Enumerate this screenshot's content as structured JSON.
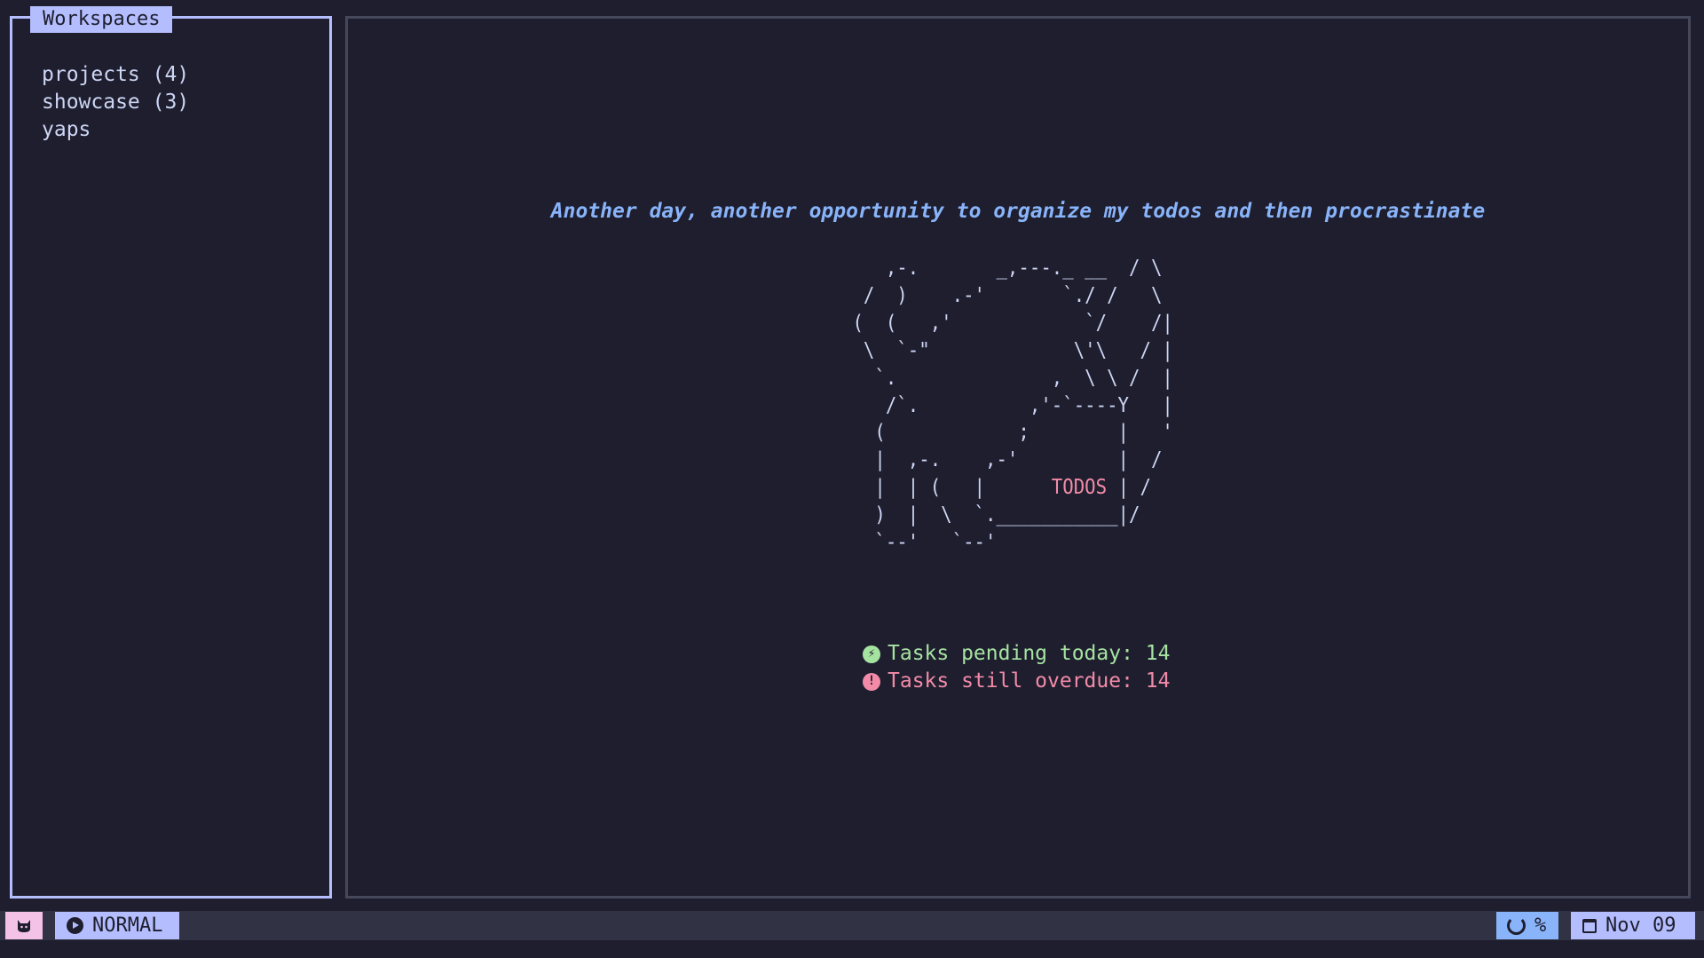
{
  "sidebar": {
    "title": "Workspaces",
    "items": [
      {
        "label": "projects (4)"
      },
      {
        "label": "showcase (3)"
      },
      {
        "label": "yaps"
      }
    ]
  },
  "main": {
    "tagline": "Another day, another opportunity to organize my todos and then procrastinate",
    "ascii_art": {
      "before": "    ,-.       _,---._ __  / \\\n  /  )    .-'       `./ /   \\\n (  (   ,'            `/    /|\n  \\  `-\"             \\'\\   / |\n   `.              ,  \\ \\ /  |\n    /`.          ,'-`----Y   |\n   (            ;        |   '\n   |  ,-.    ,-'         |  /\n   |  | (   |      ",
      "label": "TODOS",
      "after": " | /\n   )  |  \\  `.___________|/\n   `--'   `--'"
    },
    "stats": {
      "pending_label": "Tasks pending today: 14",
      "overdue_label": "Tasks still overdue: 14"
    }
  },
  "statusbar": {
    "cat_icon": "cat-icon",
    "mode": "NORMAL",
    "progress": "%",
    "date": "Nov 09"
  },
  "colors": {
    "background": "#1e1e2e",
    "accent": "#b4befe",
    "tagline": "#89b4fa",
    "pending": "#a6e3a1",
    "overdue": "#f38ba8"
  }
}
